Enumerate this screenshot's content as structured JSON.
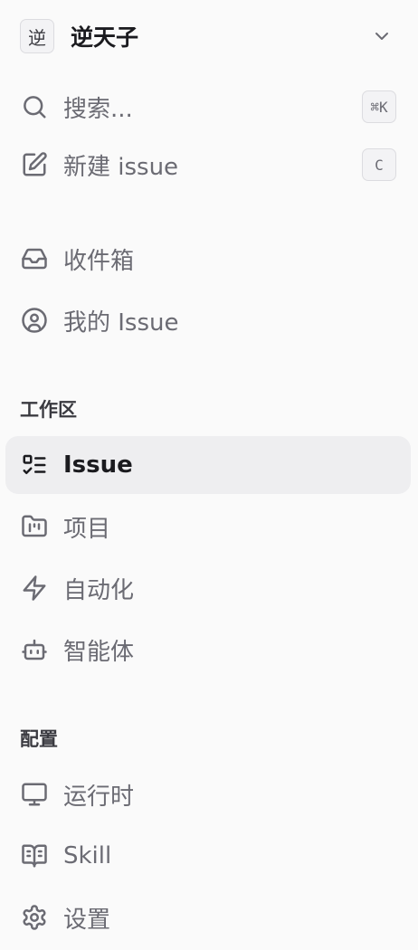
{
  "workspace": {
    "avatar_text": "逆",
    "name": "逆天子"
  },
  "actions": {
    "search_label": "搜索...",
    "search_shortcut": "⌘K",
    "new_issue_label": "新建 issue",
    "new_issue_shortcut": "C"
  },
  "personal": {
    "inbox_label": "收件箱",
    "my_issues_label": "我的 Issue"
  },
  "workspace_section": {
    "title": "工作区",
    "items": [
      {
        "label": "Issue",
        "icon": "list-todo-icon",
        "active": true
      },
      {
        "label": "项目",
        "icon": "folder-kanban-icon",
        "active": false
      },
      {
        "label": "自动化",
        "icon": "zap-icon",
        "active": false
      },
      {
        "label": "智能体",
        "icon": "bot-icon",
        "active": false
      }
    ]
  },
  "config_section": {
    "title": "配置",
    "items": [
      {
        "label": "运行时",
        "icon": "monitor-icon"
      },
      {
        "label": "Skill",
        "icon": "book-open-icon"
      },
      {
        "label": "设置",
        "icon": "gear-icon"
      }
    ]
  },
  "colors": {
    "background": "#fafafa",
    "active_background": "#eeeef0",
    "text_muted": "#6b6b73",
    "text_strong": "#1b1b1f"
  }
}
